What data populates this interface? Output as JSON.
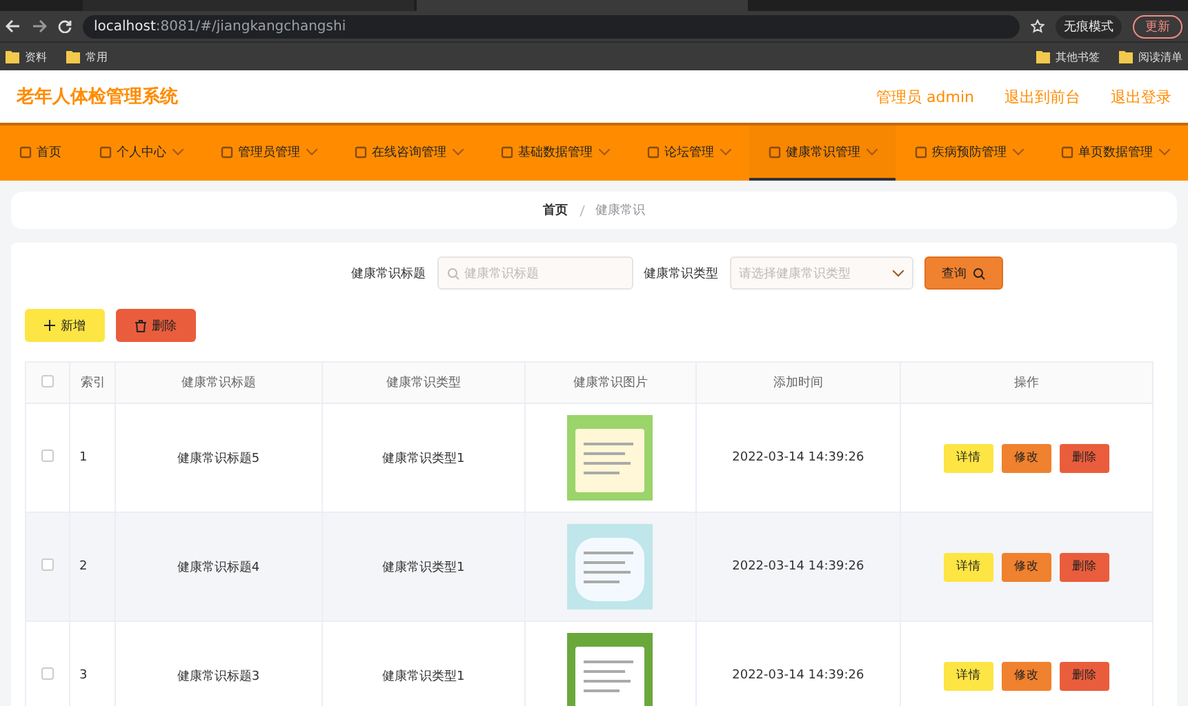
{
  "browser": {
    "address": {
      "host": "localhost",
      "path": ":8081/#/jiangkangchangshi"
    },
    "incognito": "无痕模式",
    "update": "更新",
    "bookmarks": [
      "资料",
      "常用"
    ],
    "bookmarks_right": [
      "其他书签",
      "阅读清单"
    ]
  },
  "header": {
    "title": "老年人体检管理系统",
    "links": [
      "管理员 admin",
      "退出到前台",
      "退出登录"
    ]
  },
  "nav": [
    {
      "label": "首页",
      "selected": false,
      "dropdown": false
    },
    {
      "label": "个人中心",
      "selected": false,
      "dropdown": true
    },
    {
      "label": "管理员管理",
      "selected": false,
      "dropdown": true
    },
    {
      "label": "在线咨询管理",
      "selected": false,
      "dropdown": true
    },
    {
      "label": "基础数据管理",
      "selected": false,
      "dropdown": true
    },
    {
      "label": "论坛管理",
      "selected": false,
      "dropdown": true
    },
    {
      "label": "健康常识管理",
      "selected": true,
      "dropdown": true
    },
    {
      "label": "疾病预防管理",
      "selected": false,
      "dropdown": true
    },
    {
      "label": "单页数据管理",
      "selected": false,
      "dropdown": true
    }
  ],
  "breadcrumb": [
    "首页",
    "健康常识"
  ],
  "search": {
    "title_label": "健康常识标题",
    "title_placeholder": "健康常识标题",
    "type_label": "健康常识类型",
    "type_placeholder": "请选择健康常识类型",
    "button": "查询"
  },
  "actions": [
    "新增",
    "删除"
  ],
  "table": {
    "select_all": {
      "checked": false
    },
    "columns": [
      "索引",
      "健康常识标题",
      "健康常识类型",
      "健康常识图片",
      "添加时间",
      "操作"
    ],
    "rows": [
      {
        "checked": false,
        "index": "1",
        "title": "健康常识标题5",
        "type": "健康常识类型1",
        "time": "2022-03-14 14:39:26",
        "buttons": [
          "详情",
          "修改",
          "删除"
        ]
      },
      {
        "checked": false,
        "index": "2",
        "title": "健康常识标题4",
        "type": "健康常识类型1",
        "time": "2022-03-14 14:39:26",
        "buttons": [
          "详情",
          "修改",
          "删除"
        ]
      },
      {
        "checked": false,
        "index": "3",
        "title": "健康常识标题3",
        "type": "健康常识类型1",
        "time": "2022-03-14 14:39:26",
        "buttons": [
          "详情",
          "修改",
          "删除"
        ]
      }
    ]
  }
}
